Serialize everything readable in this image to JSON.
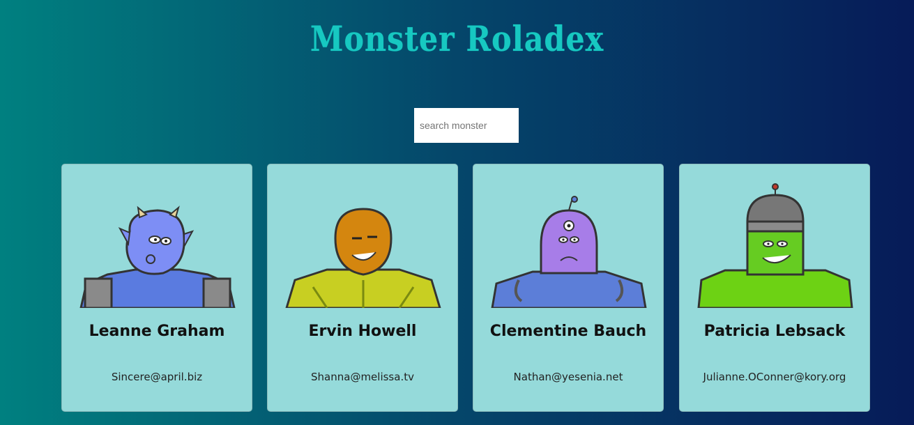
{
  "header": {
    "title": "Monster Roladex"
  },
  "search": {
    "placeholder": "search monster",
    "value": ""
  },
  "monsters": [
    {
      "name": "Leanne Graham",
      "email": "Sincere@april.biz",
      "skin": "#7d8ef5",
      "body": "#5a7be0"
    },
    {
      "name": "Ervin Howell",
      "email": "Shanna@melissa.tv",
      "skin": "#d4860f",
      "body": "#c8cf22"
    },
    {
      "name": "Clementine Bauch",
      "email": "Nathan@yesenia.net",
      "skin": "#a77de8",
      "body": "#5c7ed8"
    },
    {
      "name": "Patricia Lebsack",
      "email": "Julianne.OConner@kory.org",
      "skin": "#66cc22",
      "body": "#6dd214"
    }
  ],
  "colors": {
    "title": "#17c8c1",
    "card_background": "#95dada",
    "gradient_start": "#008080",
    "gradient_end": "#061b58"
  }
}
